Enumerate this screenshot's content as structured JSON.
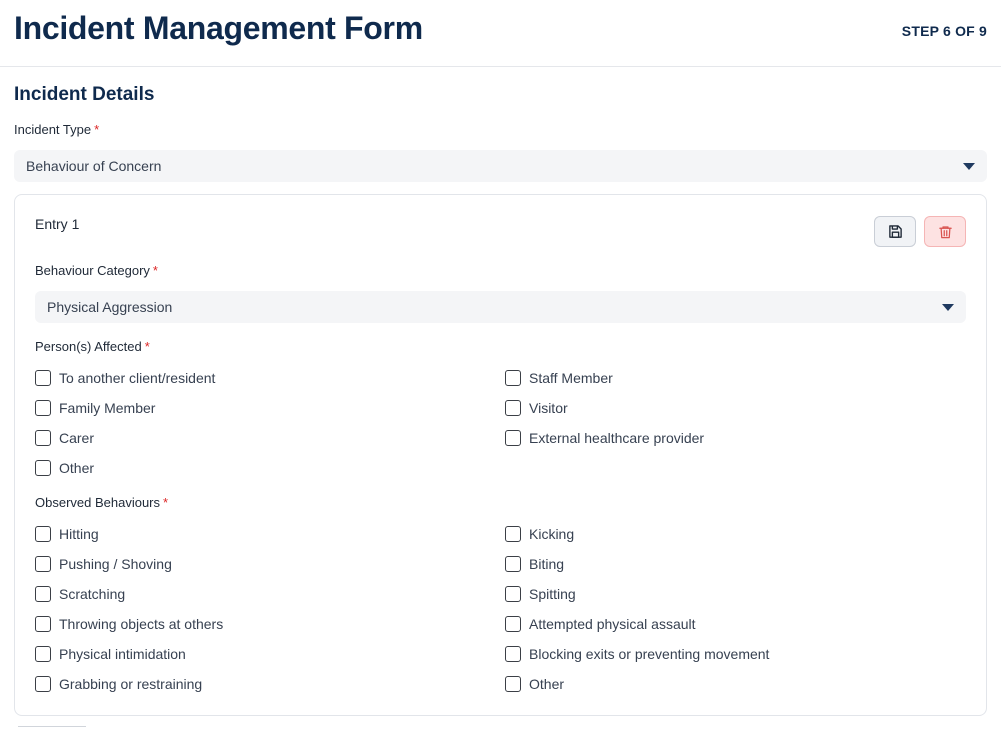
{
  "header": {
    "title": "Incident Management Form",
    "step": "STEP 6 OF 9"
  },
  "section": {
    "title": "Incident Details"
  },
  "incident_type": {
    "label": "Incident Type",
    "required_mark": "*",
    "value": "Behaviour of Concern"
  },
  "entry": {
    "title": "Entry 1",
    "save_icon": "save-icon",
    "delete_icon": "trash-icon",
    "behaviour_category": {
      "label": "Behaviour Category",
      "required_mark": "*",
      "value": "Physical Aggression"
    },
    "persons_affected": {
      "label": "Person(s) Affected",
      "required_mark": "*",
      "options": [
        "To another client/resident",
        "Staff Member",
        "Family Member",
        "Visitor",
        "Carer",
        "External healthcare provider",
        "Other"
      ]
    },
    "observed_behaviours": {
      "label": "Observed Behaviours",
      "required_mark": "*",
      "options": [
        "Hitting",
        "Kicking",
        "Pushing / Shoving",
        "Biting",
        "Scratching",
        "Spitting",
        "Throwing objects at others",
        "Attempted physical assault",
        "Physical intimidation",
        "Blocking exits or preventing movement",
        "Grabbing or restraining",
        "Other"
      ]
    }
  },
  "colors": {
    "heading": "#0f2a4d",
    "required": "#dc2626",
    "delete_bg": "#fde2e2",
    "delete_icon": "#d9534f"
  }
}
